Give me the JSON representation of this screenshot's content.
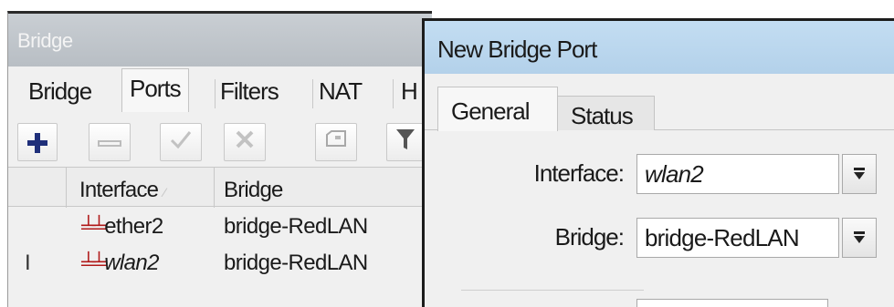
{
  "bridge_window": {
    "title": "Bridge",
    "tabs": [
      "Bridge",
      "Ports",
      "Filters",
      "NAT",
      "H"
    ],
    "active_tab": "Ports",
    "toolbar": [
      "add-icon",
      "remove-icon",
      "enable-icon",
      "disable-icon",
      "comment-icon",
      "filter-icon"
    ],
    "table": {
      "columns": [
        "Interface",
        "Bridge"
      ],
      "rows": [
        {
          "flag": "",
          "interface": "ether2",
          "bridge": "bridge-RedLAN"
        },
        {
          "flag": "I",
          "interface": "wlan2",
          "bridge": "bridge-RedLAN"
        }
      ]
    }
  },
  "dialog": {
    "title": "New Bridge Port",
    "tabs": [
      "General",
      "Status"
    ],
    "active_tab": "General",
    "fields": {
      "interface_label": "Interface:",
      "interface_value": "wlan2",
      "bridge_label": "Bridge:",
      "bridge_value": "bridge-RedLAN"
    }
  },
  "colors": {
    "bridge_title_bar": "#c0c5cb",
    "dialog_title_bar": "#b8d5ed",
    "add_icon": "#1f2f7a",
    "port_icon": "#b01818"
  }
}
